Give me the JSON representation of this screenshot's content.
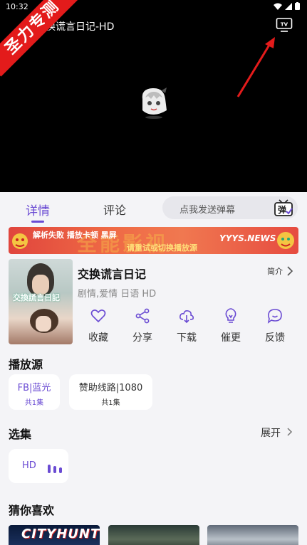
{
  "status_bar": {
    "time": "10:32"
  },
  "watermark": {
    "text": "圣力专测"
  },
  "player": {
    "title": "换谎言日记-HD"
  },
  "tabs": {
    "detail": "详情",
    "comment": "评论"
  },
  "danmaku": {
    "placeholder": "点我发送弹幕",
    "icon_text": "弹"
  },
  "banner": {
    "line1": "解析失败  播放卡顿  黑屏",
    "line2": "请重试或切换播放源",
    "site": "YYYS.NEWS",
    "deco": "全能影视"
  },
  "info": {
    "poster_text": "交換謊言日記",
    "title": "交换谎言日记",
    "tags": "剧情,爱情 日语 HD",
    "intro": "简介"
  },
  "actions": [
    {
      "label": "收藏",
      "icon": "heart-icon"
    },
    {
      "label": "分享",
      "icon": "share-icon"
    },
    {
      "label": "下载",
      "icon": "cloud-download-icon"
    },
    {
      "label": "催更",
      "icon": "lightbulb-icon"
    },
    {
      "label": "反馈",
      "icon": "chat-bubble-icon"
    }
  ],
  "sources": {
    "title": "播放源",
    "items": [
      {
        "name": "FB|蓝光",
        "count": "共1集"
      },
      {
        "name": "赞助线路|1080",
        "count": "共1集"
      }
    ]
  },
  "episodes": {
    "title": "选集",
    "expand": "展开",
    "items": [
      {
        "label": "HD"
      }
    ]
  },
  "recommend": {
    "title": "猜你喜欢",
    "items": [
      {
        "logo": "CITYHUNTER"
      }
    ]
  },
  "colors": {
    "accent": "#6a4bd3",
    "ribbon": "#e31b1b",
    "arrow": "#e31b1b",
    "banner": "#e0453d"
  }
}
